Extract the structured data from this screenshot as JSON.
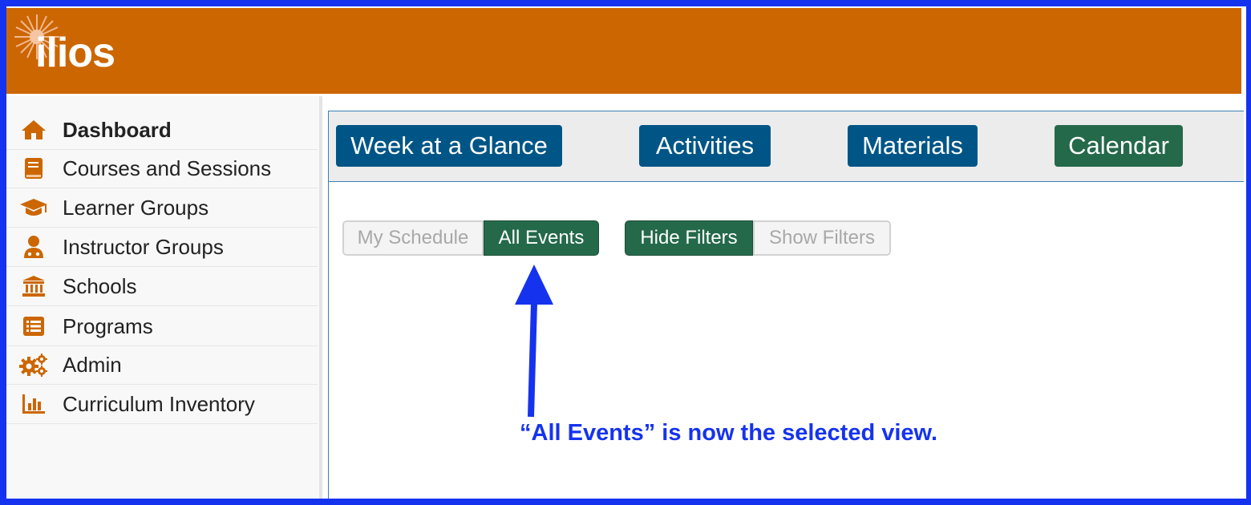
{
  "app": {
    "logo_text": "ilios"
  },
  "sidebar": {
    "items": [
      {
        "label": "Dashboard",
        "icon": "home-icon",
        "active": true
      },
      {
        "label": "Courses and Sessions",
        "icon": "book-icon"
      },
      {
        "label": "Learner Groups",
        "icon": "graduation-cap-icon"
      },
      {
        "label": "Instructor Groups",
        "icon": "instructor-icon"
      },
      {
        "label": "Schools",
        "icon": "institution-icon"
      },
      {
        "label": "Programs",
        "icon": "list-icon"
      },
      {
        "label": "Admin",
        "icon": "cogs-icon"
      },
      {
        "label": "Curriculum Inventory",
        "icon": "bar-chart-icon"
      }
    ]
  },
  "dashboard_tabs": {
    "week": "Week at a Glance",
    "activities": "Activities",
    "materials": "Materials",
    "calendar": "Calendar",
    "selected": "Calendar"
  },
  "schedule_toggle": {
    "my_schedule": "My Schedule",
    "all_events": "All Events",
    "selected": "All Events"
  },
  "filter_toggle": {
    "hide": "Hide Filters",
    "show": "Show Filters",
    "selected": "Hide Filters"
  },
  "annotation": {
    "text": "“All Events” is now the selected view."
  },
  "colors": {
    "header": "#cc6600",
    "accent_blue": "#005587",
    "accent_green": "#24694a",
    "sidebar_icon": "#cc6600",
    "annotation": "#1533ee"
  }
}
